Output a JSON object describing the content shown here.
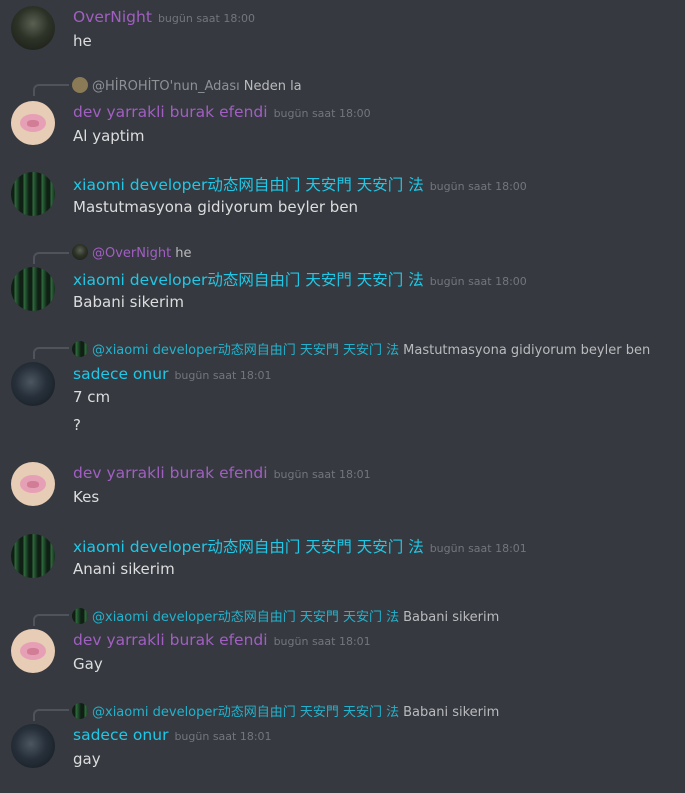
{
  "colors": {
    "background": "#36393f",
    "purple_name": "#a15fc2",
    "cyan_name": "#1fc8e6",
    "timestamp": "#72767d",
    "text": "#dcddde"
  },
  "messages": [
    {
      "author": "OverNight",
      "color": "purple",
      "avatar": "night",
      "timestamp": "bugün saat 18:00",
      "text": "he"
    },
    {
      "reply_to": {
        "name": "@HİROHİTO'nun_Adası",
        "text": "Neden la"
      },
      "author": "dev yarrakli burak efendi",
      "color": "purple",
      "avatar": "pig",
      "timestamp": "bugün saat 18:00",
      "text": "Al yaptim"
    },
    {
      "author": "xiaomi developer动态网自由门 天安門 天安门 法",
      "color": "cyan",
      "avatar": "forest",
      "timestamp": "bugün saat 18:00",
      "text": "Mastutmasyona gidiyorum beyler ben"
    },
    {
      "reply_to": {
        "name": "@OverNight",
        "text": "he"
      },
      "author": "xiaomi developer动态网自由门 天安門 天安门 法",
      "color": "cyan",
      "avatar": "forest",
      "timestamp": "bugün saat 18:00",
      "text": "Babani sikerim"
    },
    {
      "reply_to": {
        "name": "@xiaomi developer动态网自由门 天安門 天安门 法",
        "text": "Mastutmasyona gidiyorum beyler ben"
      },
      "author": "sadece onur",
      "color": "cyan",
      "avatar": "dark",
      "timestamp": "bugün saat 18:01",
      "text": "7 cm",
      "text2": "?"
    },
    {
      "author": "dev yarrakli burak efendi",
      "color": "purple",
      "avatar": "pig",
      "timestamp": "bugün saat 18:01",
      "text": "Kes"
    },
    {
      "author": "xiaomi developer动态网自由门 天安門 天安门 法",
      "color": "cyan",
      "avatar": "forest",
      "timestamp": "bugün saat 18:01",
      "text": "Anani sikerim"
    },
    {
      "reply_to": {
        "name": "@xiaomi developer动态网自由门 天安門 天安门 法",
        "text": "Babani sikerim"
      },
      "author": "dev yarrakli burak efendi",
      "color": "purple",
      "avatar": "pig",
      "timestamp": "bugün saat 18:01",
      "text": "Gay"
    },
    {
      "reply_to": {
        "name": "@xiaomi developer动态网自由门 天安門 天安门 法",
        "text": "Babani sikerim"
      },
      "author": "sadece onur",
      "color": "cyan",
      "avatar": "dark",
      "timestamp": "bugün saat 18:01",
      "text": "gay"
    }
  ]
}
